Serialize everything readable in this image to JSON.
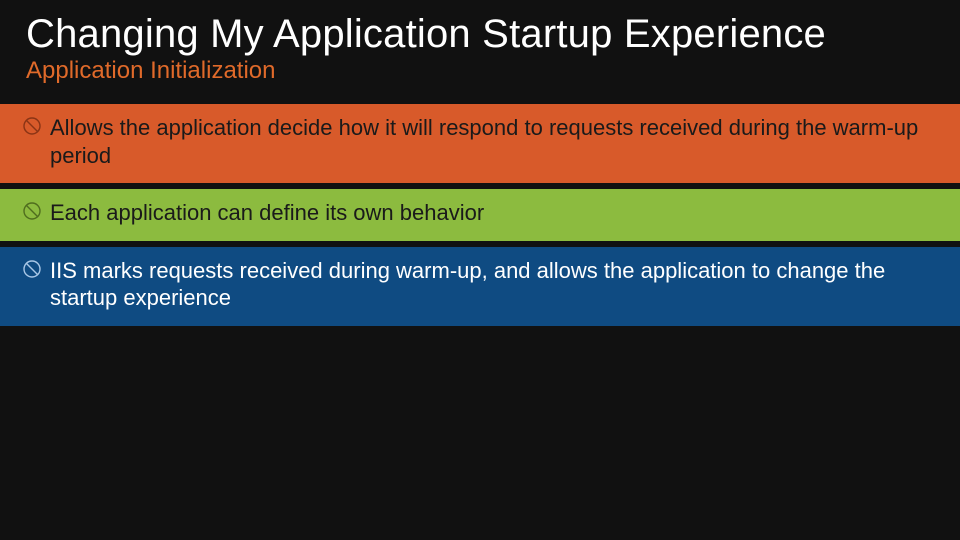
{
  "title": "Changing My Application Startup Experience",
  "subtitle": "Application Initialization",
  "bullets": [
    {
      "color": "orange",
      "text": "Allows the application decide how it will respond to requests received during the warm-up period"
    },
    {
      "color": "green",
      "text": "Each application can define its own behavior"
    },
    {
      "color": "blue",
      "text": "IIS marks requests received during warm-up, and allows the application to change the startup experience"
    }
  ]
}
